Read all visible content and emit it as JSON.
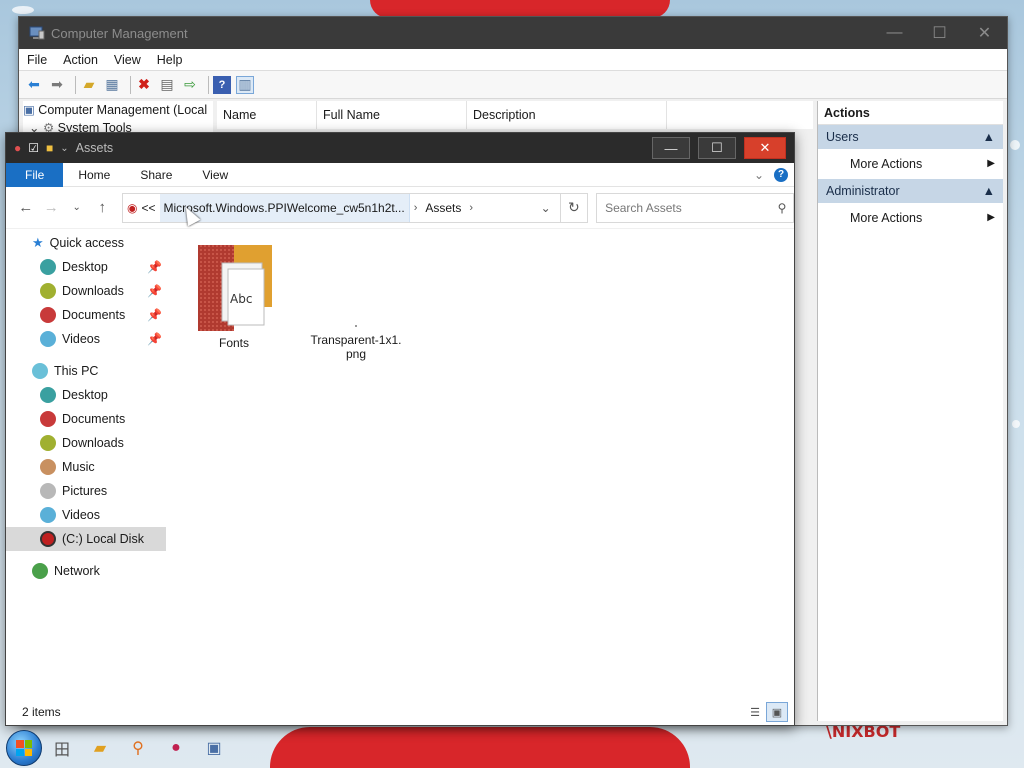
{
  "colors": {
    "accent": "#1a6fc4",
    "close_red": "#d7402b",
    "actions_group": "#c6d6e6"
  },
  "computer_management": {
    "title": "Computer Management",
    "menu": [
      "File",
      "Action",
      "View",
      "Help"
    ],
    "tree": [
      {
        "label": "Computer Management (Local",
        "icon": "computer-management-icon"
      },
      {
        "label": "System Tools",
        "icon": "tools-icon"
      }
    ],
    "columns": [
      "Name",
      "Full Name",
      "Description"
    ],
    "actions": {
      "header": "Actions",
      "groups": [
        {
          "label": "Users",
          "items": [
            "More Actions"
          ]
        },
        {
          "label": "Administrator",
          "items": [
            "More Actions"
          ]
        }
      ]
    }
  },
  "explorer": {
    "title": "Assets",
    "ribbon_tabs": [
      "File",
      "Home",
      "Share",
      "View"
    ],
    "address": {
      "overflow": "<<",
      "segments": [
        "Microsoft.Windows.PPIWelcome_cw5n1h2t...",
        "Assets"
      ]
    },
    "search_placeholder": "Search Assets",
    "nav": {
      "quick_access": "Quick access",
      "quick_items": [
        "Desktop",
        "Downloads",
        "Documents",
        "Videos"
      ],
      "this_pc": "This PC",
      "pc_items": [
        "Desktop",
        "Documents",
        "Downloads",
        "Music",
        "Pictures",
        "Videos",
        "(C:) Local Disk"
      ],
      "network": "Network"
    },
    "files": [
      {
        "name": "Fonts",
        "type": "folder"
      },
      {
        "name": "Transparent-1x1.\npng",
        "type": "image"
      }
    ],
    "status": "2 items"
  },
  "taskbar": [
    "start-button",
    "fonts-task",
    "explorer-task",
    "search-task",
    "app-task",
    "computer-management-task"
  ]
}
